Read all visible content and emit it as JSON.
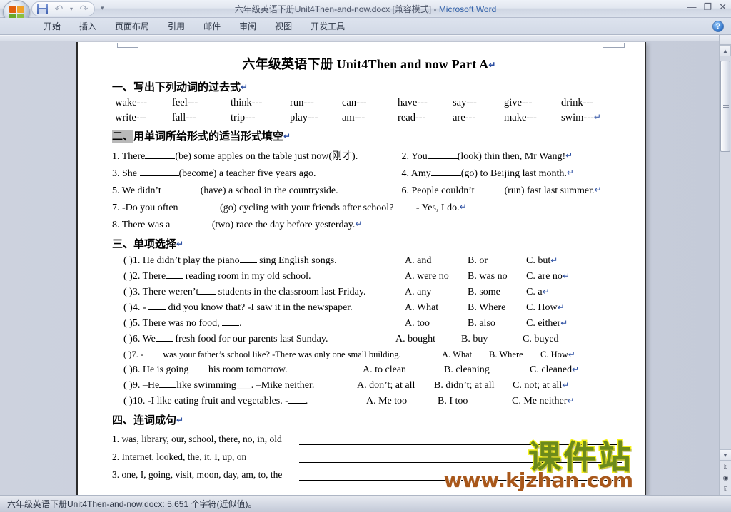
{
  "window": {
    "title_doc": "六年级英语下册Unit4Then-and-now.docx [兼容模式]",
    "title_sep": " - ",
    "app_name": "Microsoft Word",
    "minimize": "—",
    "restore": "❐",
    "close": "✕",
    "help": "?"
  },
  "qat": {
    "save": "save-icon",
    "undo": "↶",
    "undo_caret": "▾",
    "redo": "↷",
    "more": "▾"
  },
  "ribbon": {
    "tabs": [
      {
        "label": "开始"
      },
      {
        "label": "插入"
      },
      {
        "label": "页面布局"
      },
      {
        "label": "引用"
      },
      {
        "label": "邮件"
      },
      {
        "label": "审阅"
      },
      {
        "label": "视图"
      },
      {
        "label": "开发工具"
      }
    ]
  },
  "document": {
    "title": "六年级英语下册 Unit4Then and now Part A",
    "pilcrow": "↵",
    "section1": {
      "heading_highlight": "",
      "heading": "一、写出下列动词的过去式",
      "row1": [
        "wake---",
        "feel---",
        "think---",
        "run---",
        "can---",
        "have---",
        "say---",
        "give---",
        "drink---"
      ],
      "row2": [
        "write---",
        "fall---",
        "trip---",
        "play---",
        "am---",
        "read---",
        "are---",
        "make---",
        "swim---"
      ]
    },
    "section2": {
      "heading_highlight": "二、",
      "heading_rest": "用单词所给形式的适当形式填空",
      "items": [
        {
          "left_a": "1. There",
          "left_b": "(be) some apples on the table just now(刚才).",
          "right_a": "2. You",
          "right_b": "(look) thin then, Mr Wang!"
        },
        {
          "left_a": "3. She ",
          "left_b": "(become) a teacher five years ago.",
          "right_a": "4. Amy",
          "right_b": "(go) to Beijing last month."
        },
        {
          "left_a": "5. We didn’t",
          "left_b": "(have) a school in the countryside.",
          "right_a": "6. People couldn’t",
          "right_b": "(run) fast last summer."
        }
      ],
      "item7_a": "7. -Do you often ",
      "item7_b": "(go) cycling with your friends after school?",
      "item7_c": "- Yes, I do.",
      "item8_a": "8. There was a ",
      "item8_b": "(two) race the day before yesterday."
    },
    "section3": {
      "heading": "三、单项选择",
      "rows": [
        {
          "mark": "(    )1.",
          "q_a": "He didn’t play the piano",
          "q_b": " sing English songs.",
          "a": "A. and",
          "b": "B. or",
          "c": "C. but"
        },
        {
          "mark": "(    )2.",
          "q_a": "There",
          "q_b": " reading room in my old school.",
          "a": "A. were no",
          "b": "B. was no",
          "c": "C. are no"
        },
        {
          "mark": "(    )3.",
          "q_a": "There weren’t",
          "q_b": " students in the classroom last Friday.",
          "a": "A. any",
          "b": "B. some",
          "c": "C. a"
        },
        {
          "mark": "(    )4.",
          "q_a": "- ",
          "q_b": " did you know that?   -I saw it in the newspaper.",
          "a": "A. What",
          "b": "B. Where",
          "c": "C. How"
        },
        {
          "mark": "(    )5.",
          "q_a": "There was no food, ",
          "q_b": ".",
          "a": "A. too",
          "b": "B. also",
          "c": "C. either"
        },
        {
          "mark": "(    )6.",
          "q_a": "We",
          "q_b": " fresh food for our parents last Sunday.",
          "a": "A. bought",
          "b": "B. buy",
          "c": "C. buyed"
        },
        {
          "mark": "(    )7.",
          "q_a": "-",
          "q_b": " was your father’s school like?  -There was only one small building.",
          "a": "A. What",
          "b": "B. Where",
          "c": "C. How"
        },
        {
          "mark": "(    )8.",
          "q_a": "He is going",
          "q_b": " his room tomorrow.",
          "a": "A. to clean",
          "b": "B. cleaning",
          "c": "C. cleaned"
        },
        {
          "mark": "(    )9.",
          "q_a": "–He",
          "q_b": "like swimming___.  –Mike neither.",
          "a": "A. don’t; at all",
          "b": "B. didn’t; at all",
          "c": "C. not; at all"
        },
        {
          "mark": "(    )10.",
          "q_a": "-I like eating fruit and vegetables.  -",
          "q_b": ".",
          "a": "A. Me too",
          "b": "B. I too",
          "c": "C. Me neither"
        }
      ]
    },
    "section4": {
      "heading": "四、连词成句",
      "rows": [
        {
          "words": "1. was, library,  our, school, there, no, in, old"
        },
        {
          "words": "2. Internet, looked, the, it, I, up, on"
        },
        {
          "words": "3. one, I, going, visit, moon, day, am, to, the"
        }
      ]
    }
  },
  "watermark": {
    "cn": "课件站",
    "url": "www.kjzhan.com",
    "color_cn": "#6c8a1b",
    "color_cn_stroke": "#f5f11a",
    "color_url": "#a8571a"
  },
  "scrollbar": {
    "split": "▬",
    "up": "▲",
    "down": "▼",
    "prev_page": "⍐",
    "select_object": "◉",
    "next_page": "⍗"
  },
  "statusbar": {
    "text": "六年级英语下册Unit4Then-and-now.docx: 5,651 个字符(近似值)。"
  }
}
